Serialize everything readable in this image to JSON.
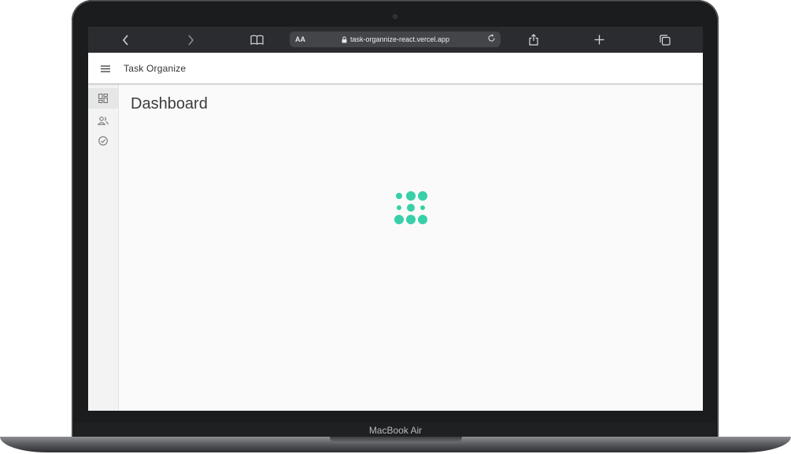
{
  "device": {
    "model_label": "MacBook Air"
  },
  "browser": {
    "url_prefix": "AA",
    "url": "task-organnize-react.vercel.app",
    "back_icon": "chevron-left-icon",
    "forward_icon": "chevron-right-icon",
    "bookmarks_icon": "book-icon",
    "share_icon": "share-icon",
    "new_tab_icon": "plus-icon",
    "tabs_icon": "tabs-icon"
  },
  "app": {
    "title": "Task Organize",
    "accent_color": "#37d0a8"
  },
  "nav": {
    "items": [
      {
        "icon": "dashboard-icon",
        "active": true
      },
      {
        "icon": "users-icon",
        "active": false
      },
      {
        "icon": "check-circle-icon",
        "active": false
      }
    ]
  },
  "main": {
    "page_title": "Dashboard",
    "loading_icon": "loading-spinner-icon"
  }
}
